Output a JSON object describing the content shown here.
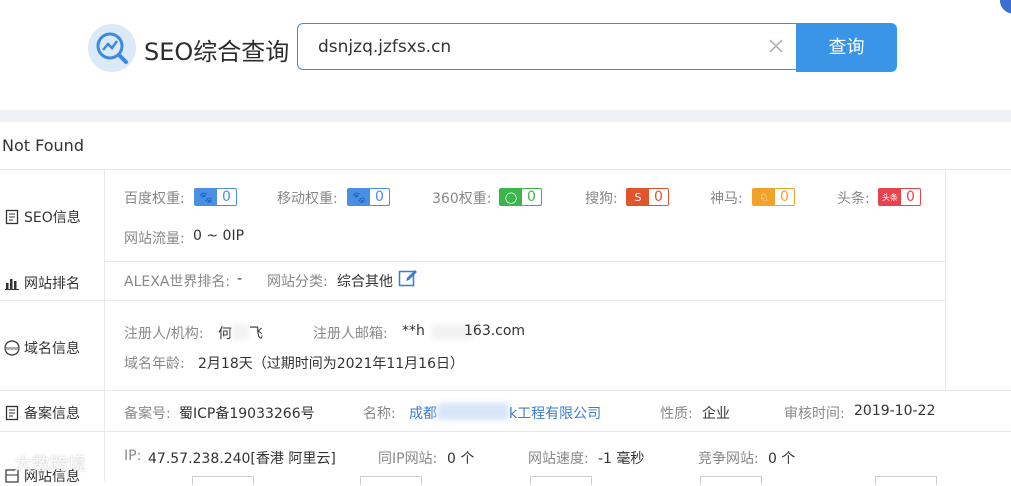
{
  "header": {
    "title": "SEO综合查询",
    "search_value": "dsnjzq.jzfsxs.cn",
    "search_button": "查询"
  },
  "status_text": "Not Found",
  "rows": {
    "seo": {
      "label": "SEO信息",
      "baidu_label": "百度权重:",
      "baidu_value": "0",
      "mobile_label": "移动权重:",
      "mobile_value": "0",
      "r360_label": "360权重:",
      "r360_value": "0",
      "sogou_label": "搜狗:",
      "sogou_value": "0",
      "shenma_label": "神马:",
      "shenma_value": "0",
      "toutiao_label": "头条:",
      "toutiao_value": "0",
      "traffic_label": "网站流量:",
      "traffic_value": "0 ~ 0IP"
    },
    "rank": {
      "label": "网站排名",
      "alexa_label": "ALEXA世界排名:",
      "alexa_value": "-",
      "category_label": "网站分类:",
      "category_value": "综合其他"
    },
    "domain": {
      "label": "域名信息",
      "registrant_label": "注册人/机构:",
      "registrant_value": "何",
      "registrant_value_tail": "飞",
      "email_label": "注册人邮箱:",
      "email_value": "**h",
      "email_value_tail": "163.com",
      "age_label": "域名年龄:",
      "age_value": "2月18天（过期时间为2021年11月16日）"
    },
    "icp": {
      "label": "备案信息",
      "number_label": "备案号:",
      "number_value": "蜀ICP备19033266号",
      "name_label": "名称:",
      "name_value_head": "成都",
      "name_value_tail": "k工程有限公司",
      "nature_label": "性质:",
      "nature_value": "企业",
      "review_label": "审核时间:",
      "review_value": "2019-10-22"
    },
    "server": {
      "label": "网站信息",
      "ip_label": "IP:",
      "ip_value": "47.57.238.240[香港 阿里云]",
      "sameip_label": "同IP网站:",
      "sameip_value": "0 个",
      "speed_label": "网站速度:",
      "speed_value": "-1 毫秒",
      "competitor_label": "竞争网站:",
      "competitor_value": "0 个"
    }
  },
  "watermark": "大数跨境",
  "colors": {
    "accent": "#3a94e8",
    "baidu": "#4a8fe3",
    "r360": "#3cb54a",
    "sogou": "#e2542c",
    "shenma": "#f2a12b",
    "toutiao": "#e8434c"
  }
}
